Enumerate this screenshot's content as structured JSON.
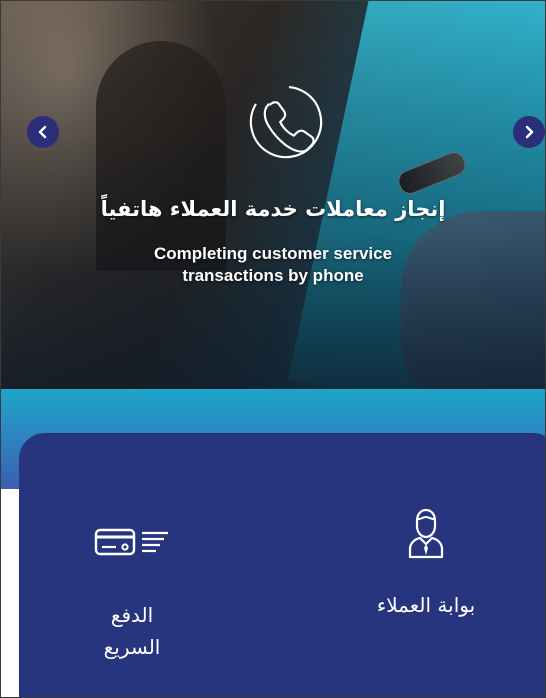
{
  "banner": {
    "title_ar": "إنجاز معاملات خدمة العملاء هاتفياً",
    "title_en_line1": "Completing customer service",
    "title_en_line2": "transactions by phone",
    "icon": "phone-icon",
    "prev_icon": "chevron-left-icon",
    "next_icon": "chevron-right-icon"
  },
  "services": {
    "portal": {
      "label": "بوابة العملاء",
      "icon": "customer-agent-icon"
    },
    "quick_pay": {
      "label_line1": "الدفع",
      "label_line2": "السريع",
      "icon": "payment-card-icon"
    }
  },
  "colors": {
    "panel": "#27357f",
    "arrow_bg": "#2b2f7a",
    "band_top": "#1ea6c9"
  }
}
